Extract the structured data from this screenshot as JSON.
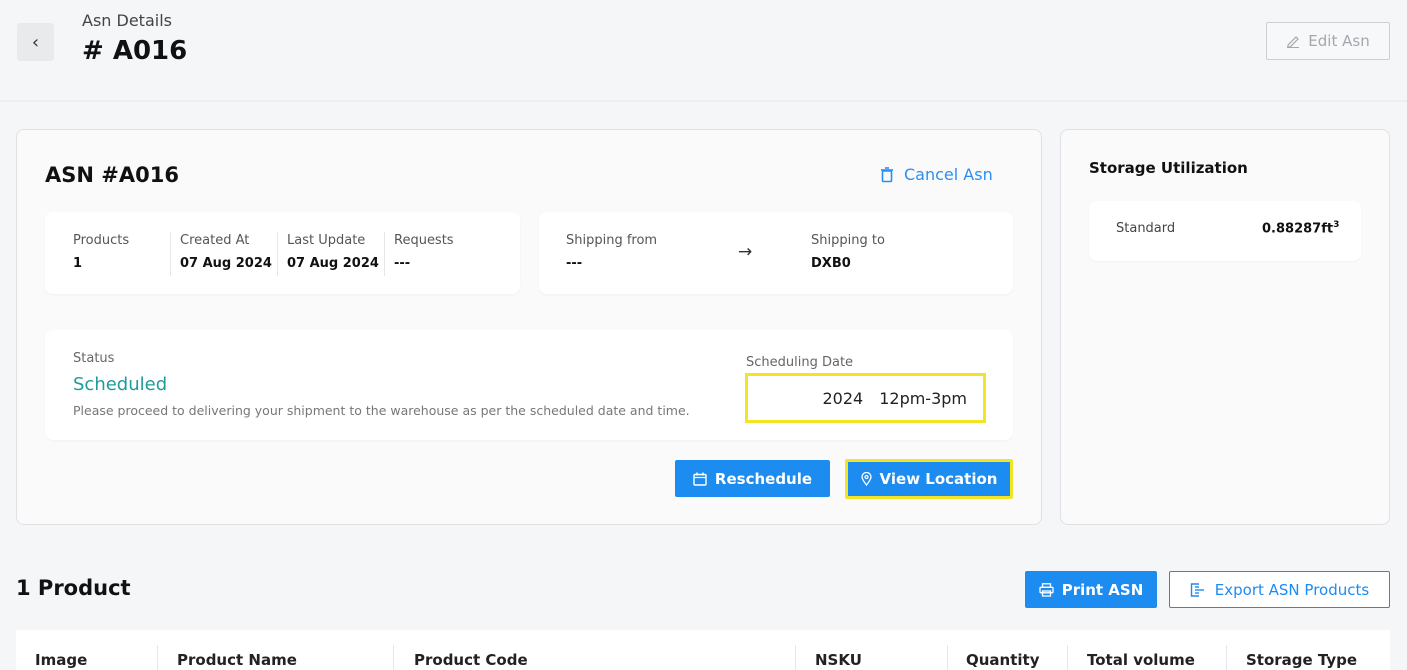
{
  "header": {
    "subtitle": "Asn Details",
    "title": "# A016",
    "back_icon": "chevron-left-icon",
    "edit_label": "Edit Asn",
    "edit_icon": "pencil-icon"
  },
  "asn": {
    "title": "ASN #A016",
    "cancel_label": "Cancel Asn",
    "cancel_icon": "trash-icon",
    "info": {
      "products_label": "Products",
      "products_value": "1",
      "created_label": "Created At",
      "created_value": "07 Aug 2024",
      "updated_label": "Last Update",
      "updated_value": "07 Aug 2024",
      "requests_label": "Requests",
      "requests_value": "---"
    },
    "shipping": {
      "from_label": "Shipping from",
      "from_value": "---",
      "arrow": "→",
      "to_label": "Shipping to",
      "to_value": "DXB0"
    },
    "status": {
      "label": "Status",
      "value": "Scheduled",
      "message": "Please proceed to delivering your shipment to the warehouse as per the scheduled date and time.",
      "scheduling_label": "Scheduling Date",
      "scheduling_year": "2024",
      "scheduling_time": "12pm-3pm"
    },
    "reschedule_label": "Reschedule",
    "reschedule_icon": "calendar-icon",
    "view_location_label": "View Location",
    "view_location_icon": "map-pin-icon"
  },
  "storage": {
    "title": "Storage Utilization",
    "type": "Standard",
    "value": "0.88287ft",
    "unit_sup": "3"
  },
  "products": {
    "title": "1 Product",
    "print_label": "Print ASN",
    "print_icon": "printer-icon",
    "export_label": "Export ASN Products",
    "export_icon": "export-icon",
    "columns": [
      "Image",
      "Product Name",
      "Product Code",
      "NSKU",
      "Quantity",
      "Total volume",
      "Storage Type"
    ]
  },
  "colors": {
    "accent": "#1d8cf0",
    "status": "#1e9c9a",
    "highlight": "#f2e526"
  }
}
